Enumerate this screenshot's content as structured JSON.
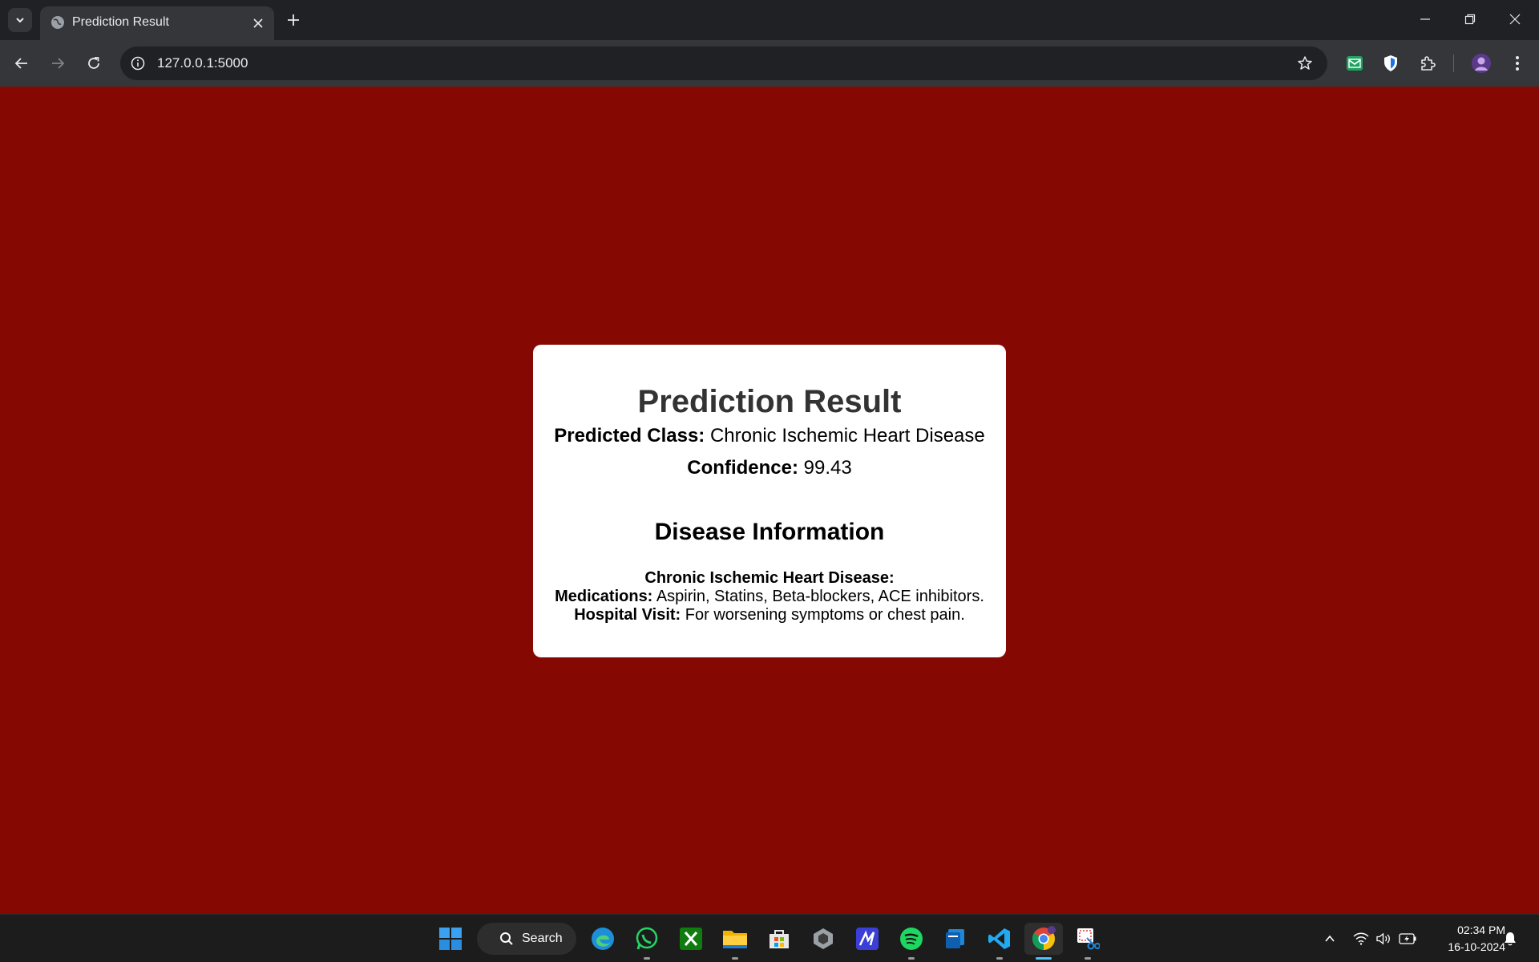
{
  "browser": {
    "tab": {
      "title": "Prediction Result"
    },
    "address_bar": {
      "url": "127.0.0.1:5000"
    }
  },
  "page": {
    "background_color": "#860802",
    "card": {
      "title": "Prediction Result",
      "predicted_class_label": "Predicted Class:",
      "predicted_class_value": "Chronic Ischemic Heart Disease",
      "confidence_label": "Confidence:",
      "confidence_value": "99.43",
      "section_heading": "Disease Information",
      "disease_name": "Chronic Ischemic Heart Disease:",
      "medications_label": "Medications:",
      "medications_value": "Aspirin, Statins, Beta-blockers, ACE inhibitors.",
      "hospital_visit_label": "Hospital Visit:",
      "hospital_visit_value": "For worsening symptoms or chest pain."
    }
  },
  "taskbar": {
    "search_label": "Search",
    "clock": {
      "time": "02:34 PM",
      "date": "16-10-2024"
    },
    "pinned_apps": [
      "start-icon",
      "edge-icon",
      "whatsapp-icon",
      "xbox-icon",
      "file-explorer-icon",
      "microsoft-store-icon",
      "unity-icon",
      "pen-app-icon",
      "spotify-icon",
      "windows-app-icon",
      "vscode-icon",
      "chrome-icon",
      "snipping-tool-icon"
    ]
  }
}
